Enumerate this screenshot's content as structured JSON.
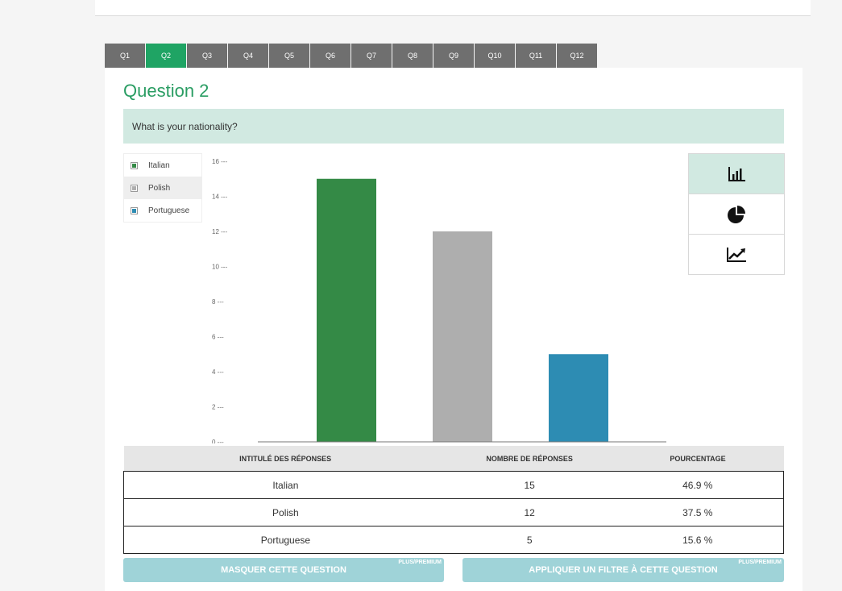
{
  "tabs": [
    "Q1",
    "Q2",
    "Q3",
    "Q4",
    "Q5",
    "Q6",
    "Q7",
    "Q8",
    "Q9",
    "Q10",
    "Q11",
    "Q12"
  ],
  "active_tab": "Q2",
  "question": {
    "title": "Question 2",
    "text": "What is your nationality?"
  },
  "legend": [
    {
      "label": "Italian",
      "color": "#348a46"
    },
    {
      "label": "Polish",
      "color": "#aeaeae"
    },
    {
      "label": "Portuguese",
      "color": "#2d8cb3"
    }
  ],
  "chart_data": {
    "type": "bar",
    "categories": [
      "Italian",
      "Polish",
      "Portuguese"
    ],
    "values": [
      15,
      12,
      5
    ],
    "colors": [
      "#348a46",
      "#aeaeae",
      "#2d8cb3"
    ],
    "ylim": [
      0,
      16
    ],
    "yticks": [
      "0 ---",
      "2 ---",
      "4 ---",
      "6 ---",
      "8 ---",
      "10 ---",
      "12 ---",
      "14 ---",
      "16 ---"
    ],
    "tick_values": [
      0,
      2,
      4,
      6,
      8,
      10,
      12,
      14,
      16
    ],
    "title": "",
    "xlabel": "",
    "ylabel": "",
    "grid": false,
    "legend_position": "left"
  },
  "chart_types": [
    {
      "name": "bar-chart-icon",
      "active": true
    },
    {
      "name": "pie-chart-icon",
      "active": false
    },
    {
      "name": "line-chart-icon",
      "active": false
    }
  ],
  "table": {
    "headers": [
      "INTITULÉ DES RÉPONSES",
      "NOMBRE DE RÉPONSES",
      "POURCENTAGE"
    ],
    "rows": [
      [
        "Italian",
        "15",
        "46.9 %"
      ],
      [
        "Polish",
        "12",
        "37.5 %"
      ],
      [
        "Portuguese",
        "5",
        "15.6 %"
      ]
    ]
  },
  "actions": {
    "hide_label": "MASQUER CETTE QUESTION",
    "filter_label": "APPLIQUER UN FILTRE À CETTE QUESTION",
    "premium_badge": "PLUS/PREMIUM"
  }
}
